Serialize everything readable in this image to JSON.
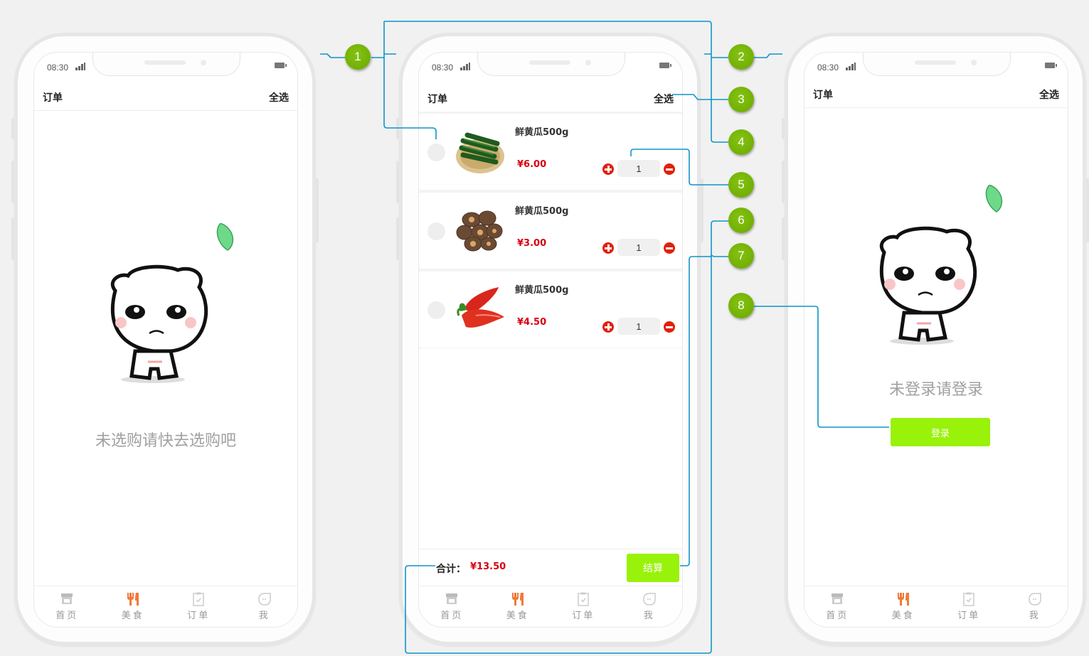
{
  "status_bar": {
    "time": "08:30"
  },
  "header": {
    "title": "订单",
    "select_all": "全选"
  },
  "tabbar": {
    "items": [
      {
        "label": "首页",
        "icon": "store-icon",
        "active": false
      },
      {
        "label": "美食",
        "icon": "fork-knife-icon",
        "active": true
      },
      {
        "label": "订单",
        "icon": "clipboard-check-icon",
        "active": false
      },
      {
        "label": "我",
        "icon": "face-icon",
        "active": false
      }
    ]
  },
  "screens": {
    "empty_cart": {
      "message": "未选购请快去选购吧"
    },
    "cart": {
      "items": [
        {
          "name": "鲜黄瓜500g",
          "price": "¥6.00",
          "quantity": "1",
          "image": "cucumber"
        },
        {
          "name": "鲜黄瓜500g",
          "price": "¥3.00",
          "quantity": "1",
          "image": "mushroom"
        },
        {
          "name": "鲜黄瓜500g",
          "price": "¥4.50",
          "quantity": "1",
          "image": "red-pepper"
        }
      ],
      "total_label": "合计：",
      "total_value": "¥13.50",
      "checkout_label": "结算"
    },
    "not_logged_in": {
      "message": "未登录请登录",
      "login_label": "登录"
    }
  },
  "annotations": {
    "callouts": [
      "1",
      "2",
      "3",
      "4",
      "5",
      "6",
      "7",
      "8"
    ],
    "line_color": "#0e95c8",
    "badge_color": "#72b100"
  },
  "colors": {
    "price_red": "#d7000f",
    "button_green": "#99f20a",
    "tab_active_orange": "#f07a3a"
  }
}
